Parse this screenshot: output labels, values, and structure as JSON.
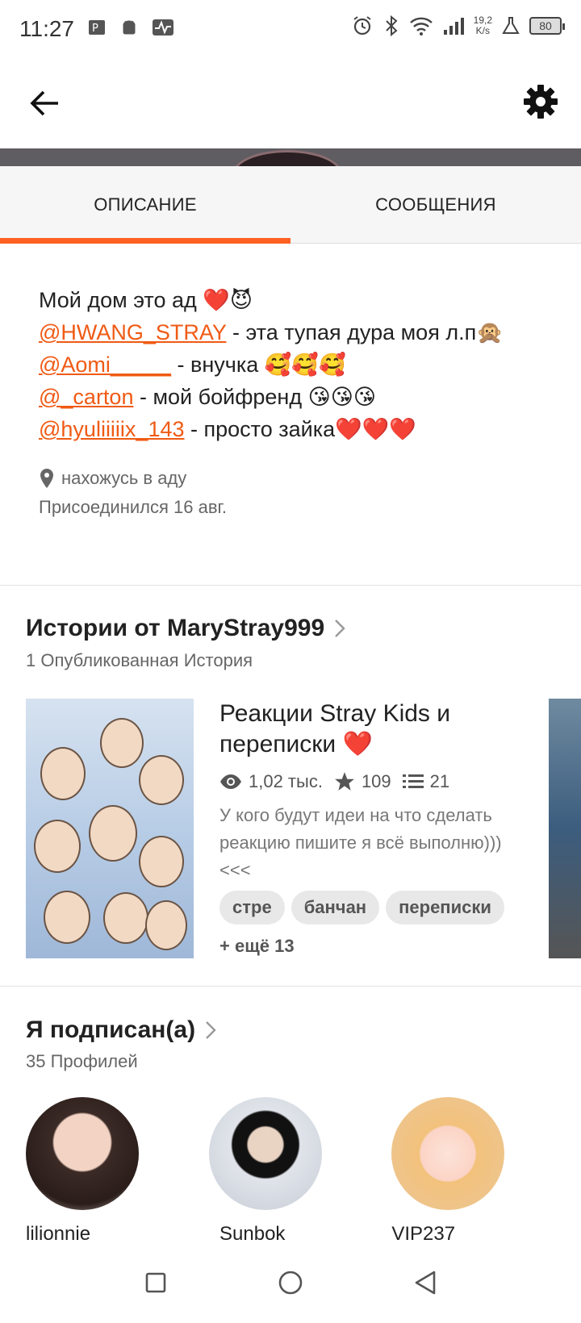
{
  "status_bar": {
    "time": "11:27",
    "net_speed_value": "19,2",
    "net_speed_unit": "K/s",
    "battery": "80"
  },
  "tabs": [
    {
      "label": "ОПИСАНИЕ",
      "active": true
    },
    {
      "label": "СООБЩЕНИЯ",
      "active": false
    }
  ],
  "about": {
    "bio_line1": "Мой дом это ад ❤️😈",
    "bio_lines": [
      {
        "mention": "@HWANG_STRAY",
        "text": " - эта тупая дура моя л.п🙊"
      },
      {
        "mention": "@Aomi_____",
        "text": " - внучка 🥰🥰🥰"
      },
      {
        "mention": "@_carton",
        "text": " - мой бойфренд 😘😘😘"
      },
      {
        "mention": "@hyuliiiiix_143",
        "text": " - просто зайка❤️❤️❤️"
      }
    ],
    "location": "нахожусь в аду",
    "joined": "Присоединился 16 авг."
  },
  "stories_section": {
    "title": "Истории от MaryStray999",
    "subtitle": "1 Опубликованная История"
  },
  "story": {
    "title": "Реакции Stray Kids и переписки ❤️",
    "views": "1,02 тыс.",
    "votes": "109",
    "parts": "21",
    "description": "У кого будут идеи на что сделать реакцию пишите я всё выполню))) <<<",
    "tags": [
      "стре",
      "банчан",
      "переписки"
    ],
    "more_tags": "+ ещё 13"
  },
  "following_section": {
    "title": "Я подписан(а)",
    "subtitle": "35 Профилей",
    "profiles": [
      {
        "name": "lilionnie"
      },
      {
        "name": "_Sunbok__"
      },
      {
        "name": "VIP237"
      }
    ]
  },
  "colors": {
    "accent": "#ff6122",
    "mention": "#f05a14"
  }
}
